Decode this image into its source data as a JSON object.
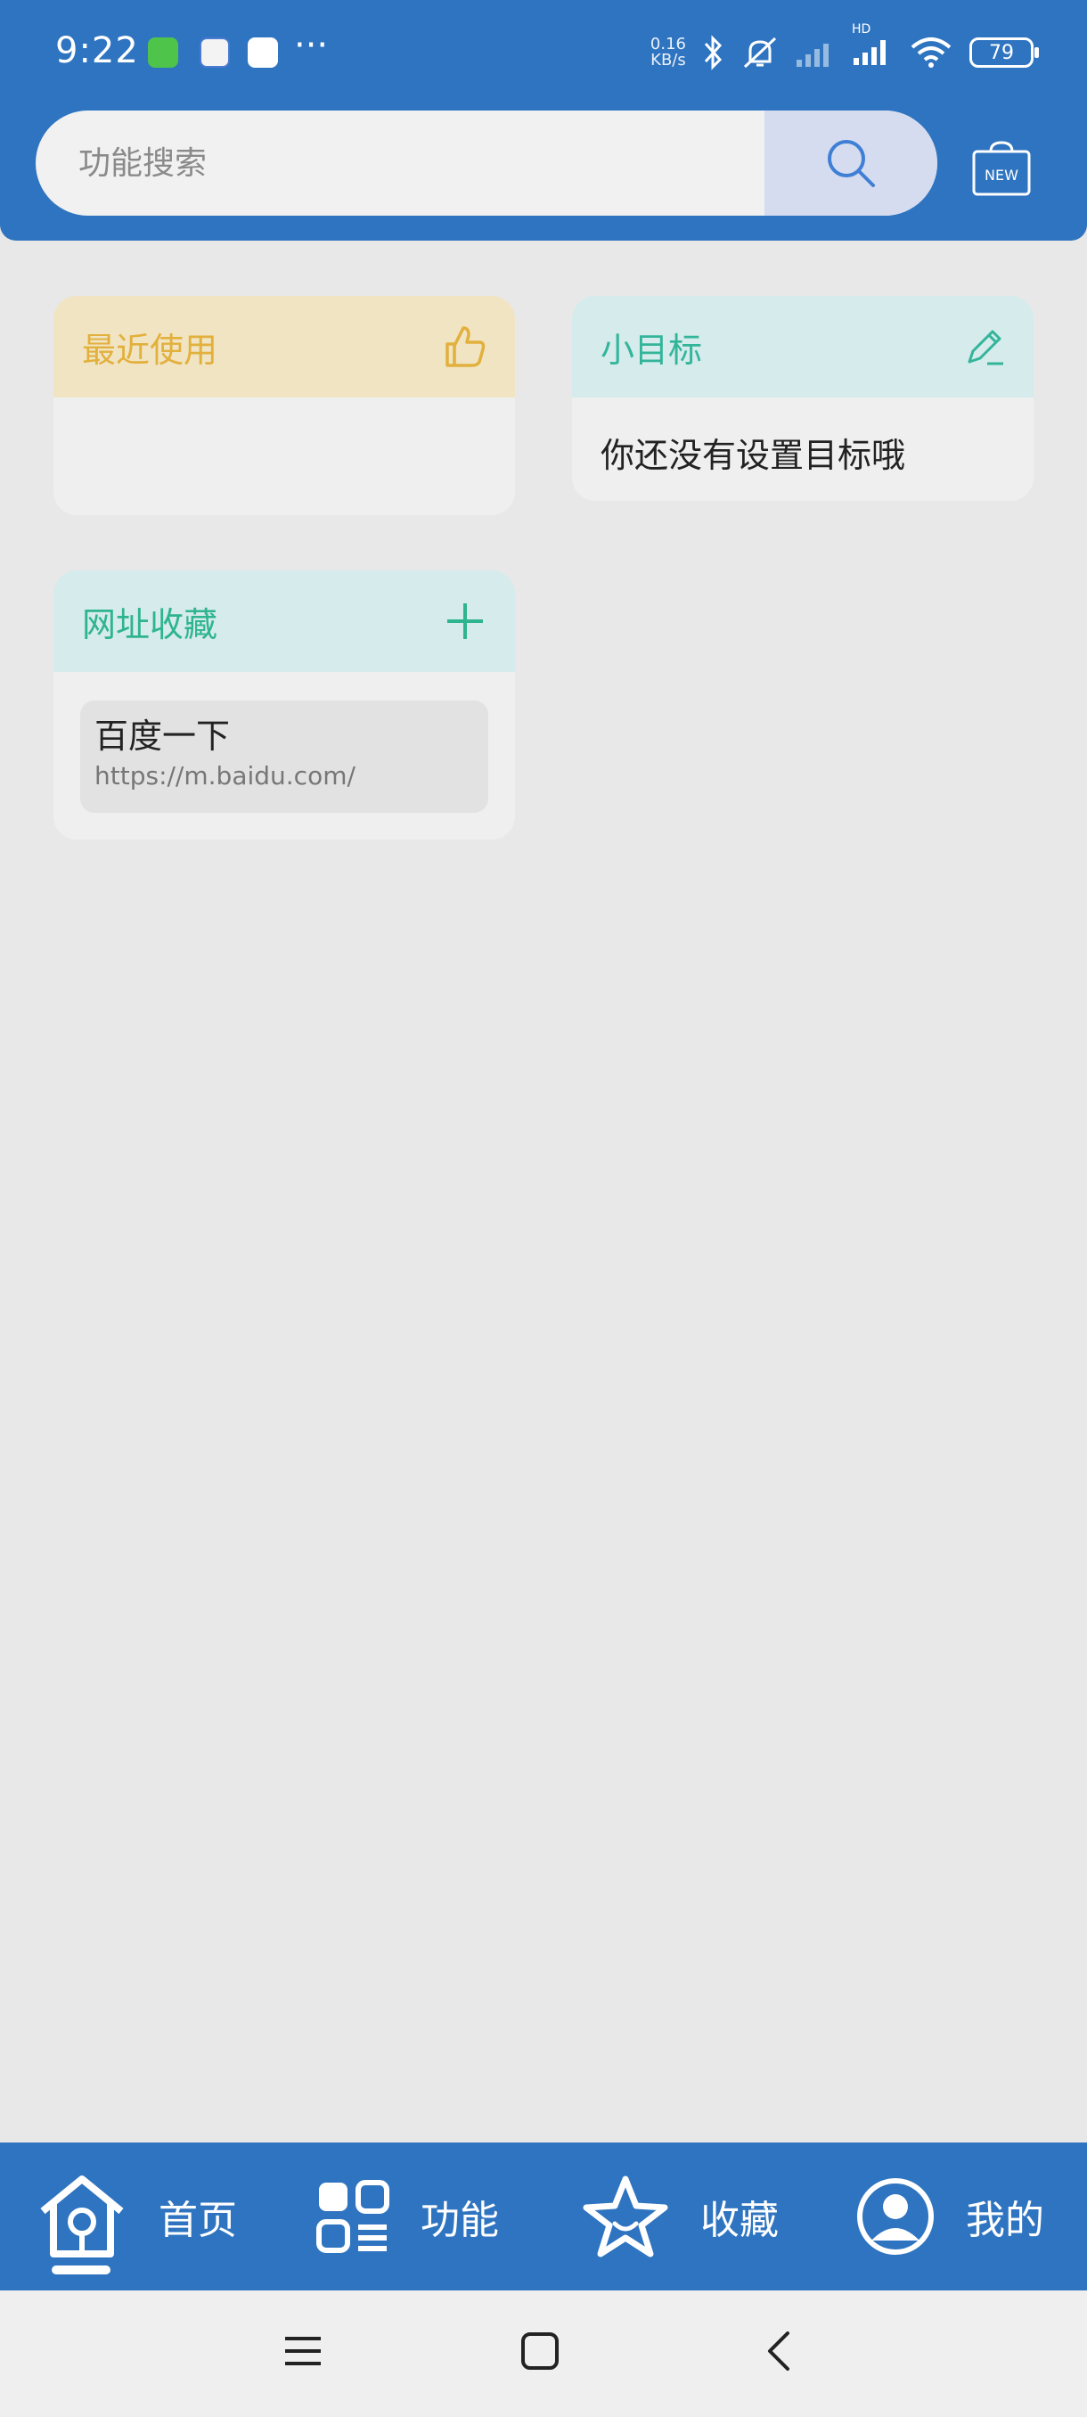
{
  "status_bar": {
    "time": "9:22",
    "more": "···",
    "net_speed_value": "0.16",
    "net_speed_unit": "KB/s",
    "network_label": "HD",
    "battery": "79"
  },
  "search": {
    "placeholder": "功能搜索"
  },
  "new_badge": "NEW",
  "cards": {
    "recent": {
      "title": "最近使用"
    },
    "goal": {
      "title": "小目标",
      "empty_text": "你还没有设置目标哦"
    },
    "favorites": {
      "title": "网址收藏",
      "items": [
        {
          "name": "百度一下",
          "url": "https://m.baidu.com/"
        }
      ]
    }
  },
  "bottom_nav": {
    "items": [
      {
        "label": "首页"
      },
      {
        "label": "功能"
      },
      {
        "label": "收藏"
      },
      {
        "label": "我的"
      }
    ]
  },
  "colors": {
    "primary": "#2f74c0",
    "recent_accent": "#e2b03c",
    "goal_accent": "#33b59a",
    "fav_accent": "#2fb491"
  }
}
